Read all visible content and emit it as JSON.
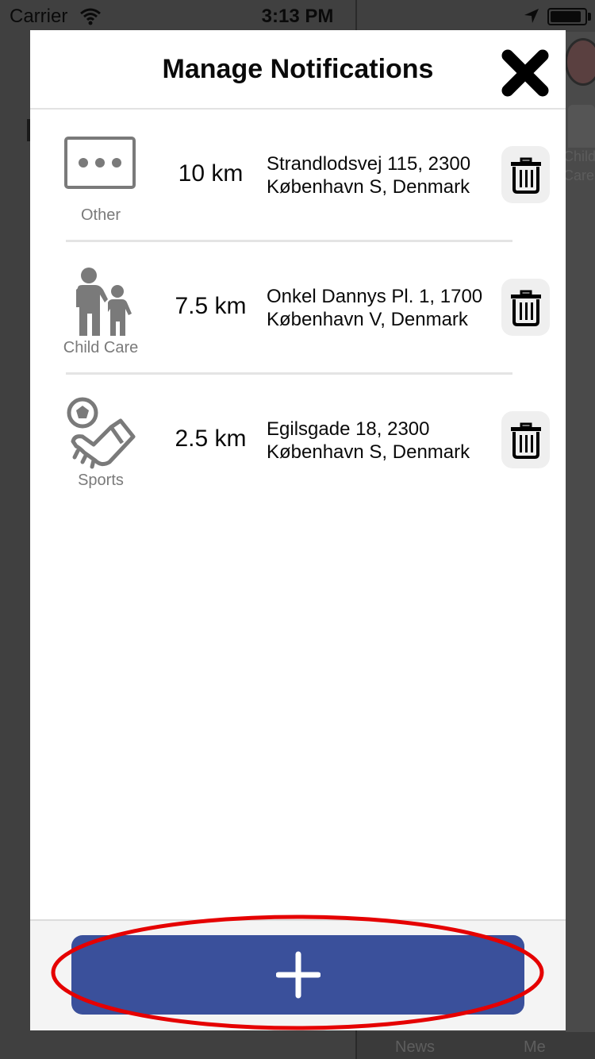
{
  "status_bar": {
    "carrier": "Carrier",
    "time": "3:13 PM",
    "battery_level": 0.9
  },
  "background": {
    "category_label": "Child\nCare",
    "tabs": [
      "News",
      "Me"
    ]
  },
  "modal": {
    "title": "Manage Notifications",
    "close_icon": "close-x-icon",
    "notifications": [
      {
        "category": "Other",
        "icon": "more-dots-icon",
        "distance": "10 km",
        "address_line1": "Strandlodsvej 115, 2300",
        "address_line2": "København S, Denmark"
      },
      {
        "category": "Child Care",
        "icon": "child-care-icon",
        "distance": "7.5 km",
        "address_line1": "Onkel Dannys Pl. 1, 1700",
        "address_line2": "København V, Denmark"
      },
      {
        "category": "Sports",
        "icon": "sports-icon",
        "distance": "2.5 km",
        "address_line1": "Egilsgade 18, 2300",
        "address_line2": "København S, Denmark"
      }
    ],
    "add_button_icon": "plus-icon"
  },
  "colors": {
    "accent": "#3a509b",
    "highlight": "#e50000",
    "icon_gray": "#7a7a7a"
  }
}
